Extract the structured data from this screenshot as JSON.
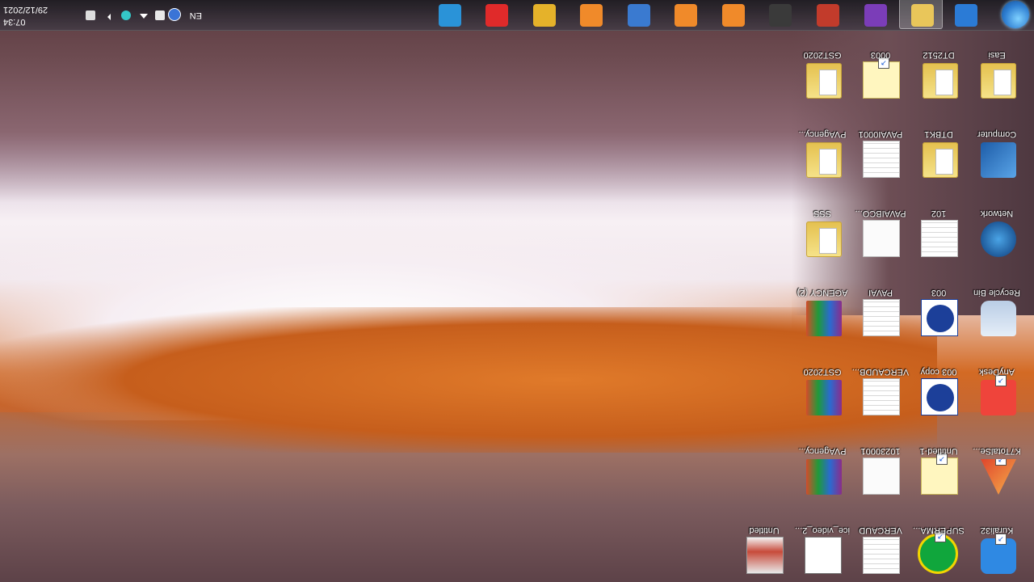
{
  "taskbar": {
    "clock_time": "07:34",
    "clock_date": "29/12/2021",
    "language": "EN",
    "pinned": [
      {
        "name": "start-button-icon"
      },
      {
        "name": "internet-explorer-icon",
        "color": "#2b7bd6"
      },
      {
        "name": "file-explorer-icon",
        "color": "#e9c65a"
      },
      {
        "name": "visual-studio-icon",
        "color": "#7b3db8"
      },
      {
        "name": "pdf-tool-icon",
        "color": "#c23b2b"
      },
      {
        "name": "media-player-icon",
        "color": "#3a3a3a"
      },
      {
        "name": "screenshot-tool-icon",
        "color": "#f08a2a"
      },
      {
        "name": "slides-app-icon",
        "color": "#f08a2a"
      },
      {
        "name": "image-viewer-icon",
        "color": "#3a7ad0"
      },
      {
        "name": "screen-recorder-icon",
        "color": "#f08a2a"
      },
      {
        "name": "chrome-icon",
        "color": "#e5b22a"
      },
      {
        "name": "opera-icon",
        "color": "#e02a2a"
      },
      {
        "name": "anydesk-taskbar-icon",
        "color": "#2a93d8"
      }
    ]
  },
  "desktop": {
    "columns": [
      {
        "icons": [
          {
            "label": "Kurali32",
            "type": "kurali"
          },
          {
            "label": "K7TotalSe...",
            "type": "k7"
          },
          {
            "label": "AnyDesk",
            "type": "anydesk"
          },
          {
            "label": "Recycle Bin",
            "type": "recycle"
          },
          {
            "label": "Network",
            "type": "network"
          },
          {
            "label": "Computer",
            "type": "computer"
          },
          {
            "label": "Easi",
            "type": "folder"
          }
        ]
      },
      {
        "icons": [
          {
            "label": "SUPERMA...",
            "type": "green-e"
          },
          {
            "label": "Untitled-1",
            "type": "yellow-doc"
          },
          {
            "label": "003 copy",
            "type": "blue-badge"
          },
          {
            "label": "003",
            "type": "blue-badge"
          },
          {
            "label": "102",
            "type": "doc-lines"
          },
          {
            "label": "DTBK1",
            "type": "folder"
          },
          {
            "label": "DT2512",
            "type": "folder"
          }
        ]
      },
      {
        "icons": [
          {
            "label": "VERCAUD",
            "type": "doc-lines"
          },
          {
            "label": "10230001",
            "type": "doc"
          },
          {
            "label": "VERCAUDB...",
            "type": "doc-lines"
          },
          {
            "label": "PAVAI",
            "type": "doc-lines"
          },
          {
            "label": "PAVAIBCO...",
            "type": "doc"
          },
          {
            "label": "PAVAI0001",
            "type": "doc-lines"
          },
          {
            "label": "0003",
            "type": "yellow-doc"
          }
        ]
      },
      {
        "icons": [
          {
            "label": "ice_video_2...",
            "type": "vid-doc"
          },
          {
            "label": "PVAgency...",
            "type": "winrar"
          },
          {
            "label": "GST2020",
            "type": "winrar"
          },
          {
            "label": "AGENCY (2)",
            "type": "winrar"
          },
          {
            "label": "SSS",
            "type": "folder"
          },
          {
            "label": "PVAgency...",
            "type": "folder"
          },
          {
            "label": "GST2020",
            "type": "folder"
          }
        ]
      },
      {
        "icons": [
          {
            "label": "Untitled",
            "type": "untitled-img"
          }
        ]
      }
    ]
  }
}
